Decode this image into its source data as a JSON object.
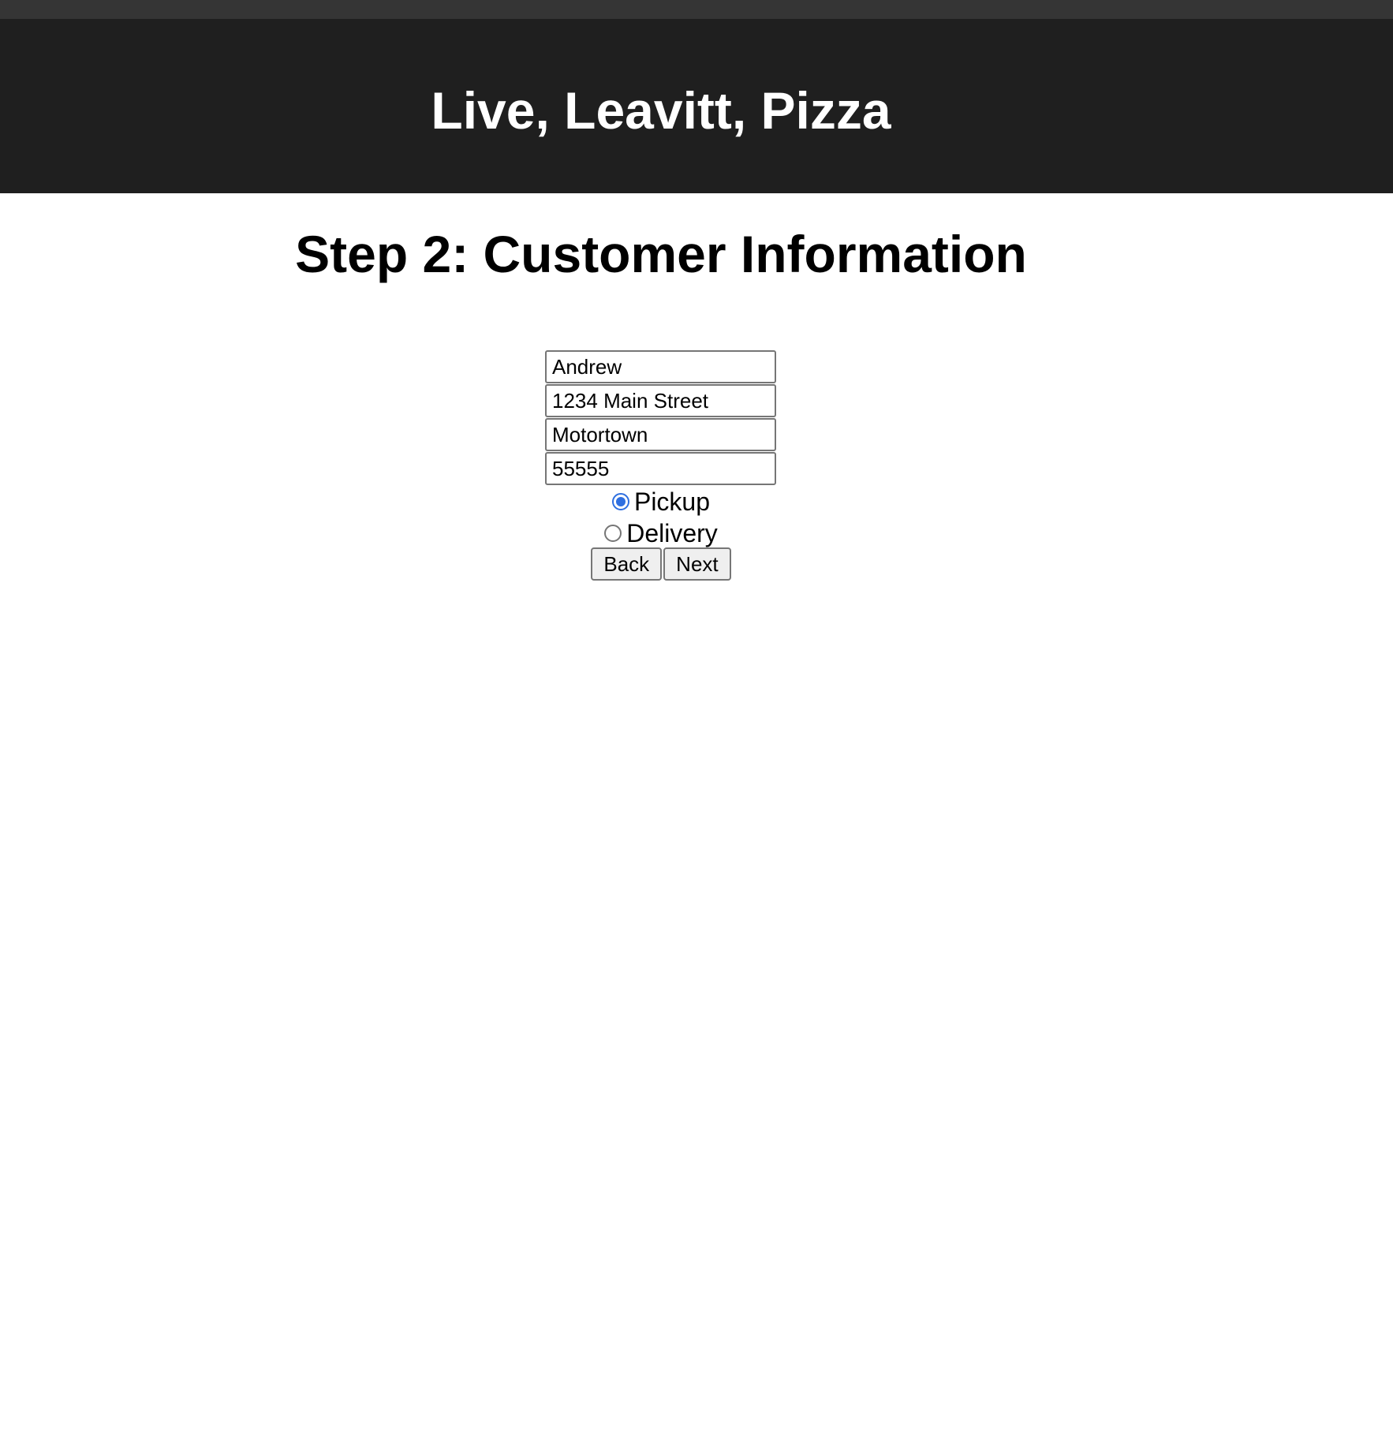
{
  "header": {
    "title": "Live, Leavitt, Pizza"
  },
  "main": {
    "step_title": "Step 2: Customer Information",
    "form": {
      "name": {
        "value": "Andrew"
      },
      "address": {
        "value": "1234 Main Street"
      },
      "city": {
        "value": "Motortown"
      },
      "zip": {
        "value": "55555"
      },
      "options": [
        {
          "label": "Pickup",
          "checked": true
        },
        {
          "label": "Delivery",
          "checked": false
        }
      ],
      "buttons": {
        "back": "Back",
        "next": "Next"
      }
    }
  },
  "colors": {
    "header_bg": "#1f1f1f",
    "top_strip": "#353535",
    "radio_accent": "#2f6fe0"
  }
}
